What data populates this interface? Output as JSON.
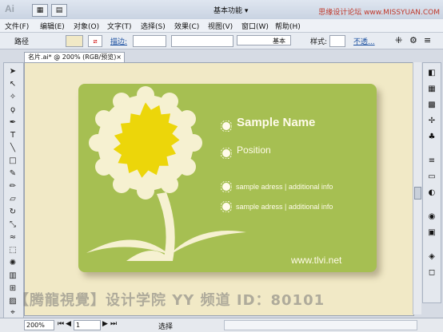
{
  "titlebar": {
    "logo": "Ai",
    "workspace": "基本功能 ▾",
    "watermark": "思缘设计论坛 www.MISSYUAN.COM"
  },
  "menu": [
    "文件(F)",
    "编辑(E)",
    "对象(O)",
    "文字(T)",
    "选择(S)",
    "效果(C)",
    "视图(V)",
    "窗口(W)",
    "帮助(H)"
  ],
  "control_bar": {
    "path_label": "路径",
    "stroke_label": "描边:",
    "style_label": "基本",
    "style2_label": "样式:",
    "opacity_label": "不透..."
  },
  "document": {
    "tab_title": "名片.ai* @ 200% (RGB/预览)",
    "close": "×"
  },
  "card": {
    "name": "Sample Name",
    "position": "Position",
    "info1": "sample adress | additional info",
    "info2": "sample adress | additional info",
    "website": "www.tlvi.net",
    "bg_color": "#a6bf52",
    "flower_petal_color": "#f6f1d1",
    "flower_center_color": "#ecd60a"
  },
  "overlay_watermark": "【腾龍視覺】设计学院 YY 频道 ID：80101",
  "statusbar": {
    "zoom": "200%",
    "page": "1",
    "mode": "选择"
  }
}
